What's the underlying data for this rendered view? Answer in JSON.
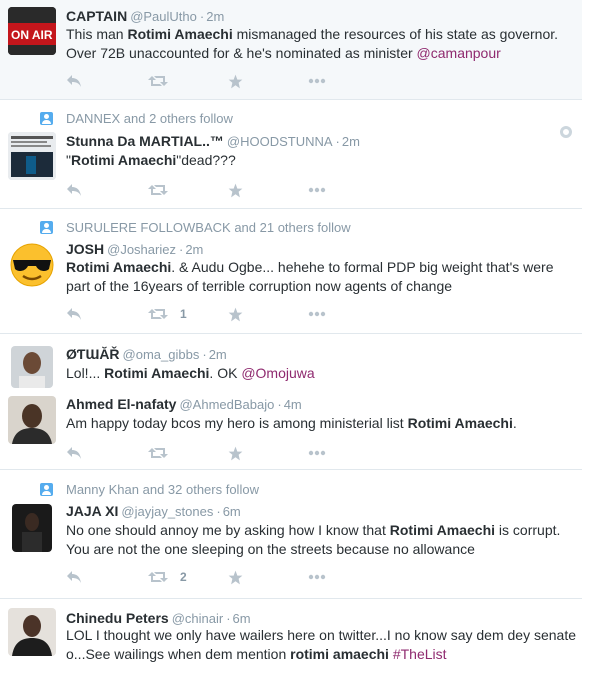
{
  "tweets": [
    {
      "name": "CAPTAIN",
      "handle": "@PaulUtho",
      "time": "2m",
      "text_pre": "This man ",
      "highlight": "Rotimi Amaechi",
      "text_post": " mismanaged the resources of his state as governor. Over 72B unaccounted for & he's nominated as minister ",
      "mention": "@camanpour",
      "retweets": "",
      "avatar_text": "ON AIR"
    },
    {
      "context": "DANNEX and 2 others follow",
      "name": "Stunna Da MARTIAL..™",
      "handle": "@HOODSTUNNA",
      "time": "2m",
      "text_pre": "\"",
      "highlight": "Rotimi Amaechi",
      "text_post": "\"dead???",
      "retweets": ""
    },
    {
      "context": "SURULERE FOLLOWBACK and 21 others follow",
      "name": "JOSH",
      "handle": "@Joshariez",
      "time": "2m",
      "text_pre": "",
      "highlight": "Rotimi Amaechi",
      "text_post": ". & Audu Ogbe... hehehe to formal PDP big weight that's were part of the 16years of terrible corruption now agents of change",
      "retweets": "1"
    },
    {
      "name": "ØƬƜĂŘ",
      "handle": "@oma_gibbs",
      "time": "2m",
      "text_pre": "Lol!... ",
      "highlight": "Rotimi Amaechi",
      "text_post": ". OK ",
      "mention": "@Omojuwa"
    },
    {
      "name": "Ahmed El-nafaty",
      "handle": "@AhmedBabajo",
      "time": "4m",
      "text_pre": "Am happy today bcos my hero is among ministerial list ",
      "highlight": "Rotimi Amaechi",
      "text_post": ".",
      "retweets": ""
    },
    {
      "context": "Manny Khan and 32 others follow",
      "name": "JAJA XI",
      "handle": "@jayjay_stones",
      "time": "6m",
      "text_pre": "No one should annoy me by asking how I know that ",
      "highlight": "Rotimi Amaechi",
      "text_post": " is corrupt. You are not the one sleeping on the streets because no allowance",
      "retweets": "2"
    },
    {
      "name": "Chinedu Peters",
      "handle": "@chinair",
      "time": "6m",
      "text_pre": "LOL I thought we only have wailers here on twitter...I no know say dem dey senate o...See wailings when dem mention ",
      "highlight": "rotimi amaechi",
      "text_post": " ",
      "mention": "#TheList"
    }
  ],
  "separator": "·",
  "colors": {
    "link": "#8f2a6f",
    "muted": "#8899a6",
    "icon": "#b8c3cc",
    "accent": "#55acee"
  }
}
